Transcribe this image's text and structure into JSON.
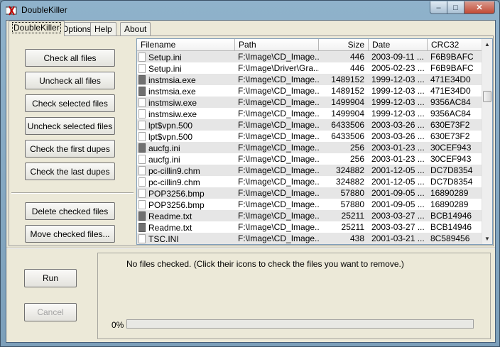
{
  "window": {
    "title": "DoubleKiller"
  },
  "tabs": [
    {
      "label": "DoubleKiller"
    },
    {
      "label": "Options"
    },
    {
      "label": "Help"
    },
    {
      "label": "About"
    }
  ],
  "buttons": {
    "check_all": "Check all files",
    "uncheck_all": "Uncheck all files",
    "check_selected": "Check selected files",
    "uncheck_selected": "Uncheck selected files",
    "check_first": "Check the first dupes",
    "check_last": "Check the last dupes",
    "delete_checked": "Delete checked files",
    "move_checked": "Move checked files...",
    "run": "Run",
    "cancel": "Cancel"
  },
  "columns": {
    "filename": "Filename",
    "path": "Path",
    "size": "Size",
    "date": "Date",
    "crc": "CRC32"
  },
  "files": [
    {
      "name": "Setup.ini",
      "path": "F:\\Image\\CD_Image...",
      "size": "446",
      "date": "2003-09-11 ...",
      "crc": "F6B9BAFC",
      "checked": false
    },
    {
      "name": "Setup.ini",
      "path": "F:\\Image\\Driver\\Gra...",
      "size": "446",
      "date": "2005-02-23 ...",
      "crc": "F6B9BAFC",
      "checked": false
    },
    {
      "name": "instmsia.exe",
      "path": "F:\\Image\\CD_Image...",
      "size": "1489152",
      "date": "1999-12-03 ...",
      "crc": "471E34D0",
      "checked": true
    },
    {
      "name": "instmsia.exe",
      "path": "F:\\Image\\CD_Image...",
      "size": "1489152",
      "date": "1999-12-03 ...",
      "crc": "471E34D0",
      "checked": true
    },
    {
      "name": "instmsiw.exe",
      "path": "F:\\Image\\CD_Image...",
      "size": "1499904",
      "date": "1999-12-03 ...",
      "crc": "9356AC84",
      "checked": false
    },
    {
      "name": "instmsiw.exe",
      "path": "F:\\Image\\CD_Image...",
      "size": "1499904",
      "date": "1999-12-03 ...",
      "crc": "9356AC84",
      "checked": false
    },
    {
      "name": "lpt$vpn.500",
      "path": "F:\\Image\\CD_Image...",
      "size": "6433506",
      "date": "2003-03-26 ...",
      "crc": "630E73F2",
      "checked": false
    },
    {
      "name": "lpt$vpn.500",
      "path": "F:\\Image\\CD_Image...",
      "size": "6433506",
      "date": "2003-03-26 ...",
      "crc": "630E73F2",
      "checked": false
    },
    {
      "name": "aucfg.ini",
      "path": "F:\\Image\\CD_Image...",
      "size": "256",
      "date": "2003-01-23 ...",
      "crc": "30CEF943",
      "checked": true
    },
    {
      "name": "aucfg.ini",
      "path": "F:\\Image\\CD_Image...",
      "size": "256",
      "date": "2003-01-23 ...",
      "crc": "30CEF943",
      "checked": false
    },
    {
      "name": "pc-cillin9.chm",
      "path": "F:\\Image\\CD_Image...",
      "size": "324882",
      "date": "2001-12-05 ...",
      "crc": "DC7D8354",
      "checked": false
    },
    {
      "name": "pc-cillin9.chm",
      "path": "F:\\Image\\CD_Image...",
      "size": "324882",
      "date": "2001-12-05 ...",
      "crc": "DC7D8354",
      "checked": false
    },
    {
      "name": "POP3256.bmp",
      "path": "F:\\Image\\CD_Image...",
      "size": "57880",
      "date": "2001-09-05 ...",
      "crc": "16890289",
      "checked": false
    },
    {
      "name": "POP3256.bmp",
      "path": "F:\\Image\\CD_Image...",
      "size": "57880",
      "date": "2001-09-05 ...",
      "crc": "16890289",
      "checked": false
    },
    {
      "name": "Readme.txt",
      "path": "F:\\Image\\CD_Image...",
      "size": "25211",
      "date": "2003-03-27 ...",
      "crc": "BCB14946",
      "checked": true
    },
    {
      "name": "Readme.txt",
      "path": "F:\\Image\\CD_Image...",
      "size": "25211",
      "date": "2003-03-27 ...",
      "crc": "BCB14946",
      "checked": true
    },
    {
      "name": "TSC.INI",
      "path": "F:\\Image\\CD_Image...",
      "size": "438",
      "date": "2001-03-21 ...",
      "crc": "8C589456",
      "checked": false
    }
  ],
  "status": {
    "message": "No files checked. (Click their icons to check the files you want to remove.)",
    "progress_label": "0%",
    "progress_value": 0
  }
}
